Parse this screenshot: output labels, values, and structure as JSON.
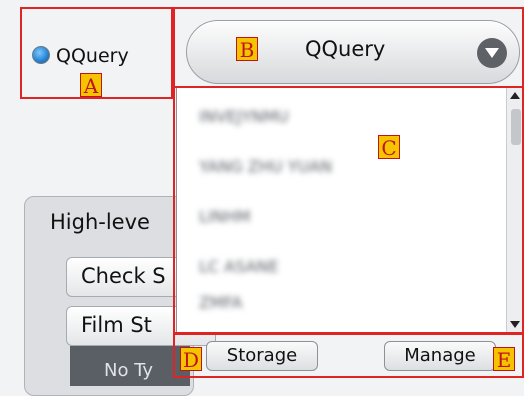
{
  "indicator": {
    "label": "QQuery"
  },
  "dropdown": {
    "selected": "QQuery"
  },
  "list": {
    "items": [
      "INVEJYNMU",
      "YANG ZHU YUAN",
      "LINHM",
      "LC ASANE",
      "ZMFA"
    ]
  },
  "panel": {
    "title": "High-leve",
    "buttons": [
      "Check S",
      "Film St"
    ],
    "sub_label": "No Ty"
  },
  "buttons": {
    "storage": "Storage",
    "manage": "Manage"
  },
  "annotations": {
    "a": "A",
    "b": "B",
    "c": "C",
    "d": "D",
    "e": "E"
  },
  "colors": {
    "annotation_border": "#e02424",
    "annotation_tag": "#f5c400",
    "accent_radio": "#2d86d6"
  }
}
